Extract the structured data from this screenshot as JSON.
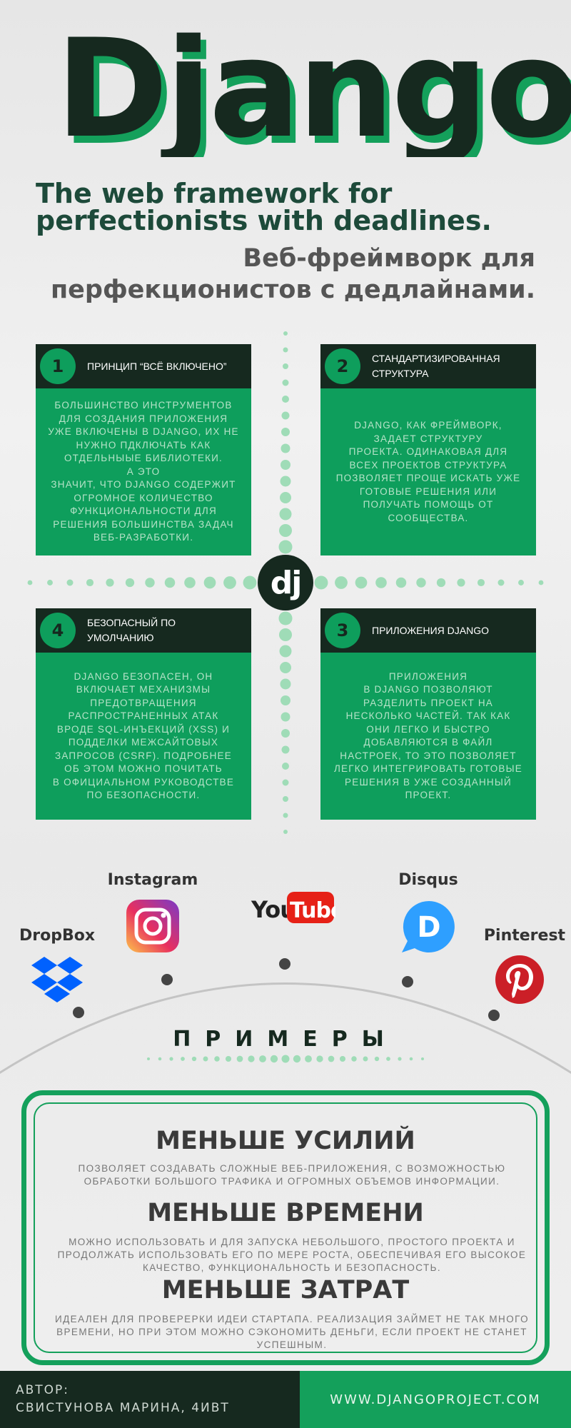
{
  "header": {
    "logo_text": "Django",
    "tagline_en_line1": "The web framework for",
    "tagline_en_line2": "perfectionists with deadlines.",
    "tagline_ru_line1": "Веб-фреймворк для",
    "tagline_ru_line2": "перфекционистов с дедлайнами."
  },
  "center_logo": "dj",
  "cards": [
    {
      "number": "1",
      "title": "ПРИНЦИП “ВСЁ ВКЛЮЧЕНО”",
      "text": "Большинство инструментов\nдля создания приложения\nуже включены в Django, их не\nнужно пдключать как\nотдельныые библиотеки.\nА это\nзначит, что Django содержит\nогромное количество\nфункциональности для\nрешения большинства задач\nвеб-разработки."
    },
    {
      "number": "2",
      "title": "СТАНДАРТИЗИРОВАННАЯ СТРУКТУРА",
      "text": "Django, как фреймворк,\nзадает структуру\nпроекта. Одинаковая для\nвсех проектов структура\nпозволяет проще искать уже\nготовые решения или\nполучать помощь от\nсообщества."
    },
    {
      "number": "3",
      "title": "ПРИЛОЖЕНИЯ DJANGO",
      "text": "Приложения\nв Django позволяют\nразделить проект на\nнесколько частей. Так как\nони легко и быстро\nдобавляются в файл\nнастроек, то это позволяет\nлегко интегрировать готовые\nрешения в уже созданный\nпроект."
    },
    {
      "number": "4",
      "title": "БЕЗОПАСНЫЙ ПО УМОЛЧАНИЮ",
      "text": "Django безопасен, он\nвключает механизмы\nпредотвращения\nраспространенных атак\nвроде SQL-инъекций (XSS) и\nподделки межсайтовых\nзапросов (CSRF). Подробнее\nоб этом можно почитать\nв официальном руководстве\nпо безопасности."
    }
  ],
  "examples": {
    "title": "ПРИМЕРЫ",
    "instagram": "Instagram",
    "disqus": "Disqus",
    "dropbox": "DropBox",
    "pinterest": "Pinterest",
    "youtube_you": "You",
    "youtube_tube": "Tube",
    "disqus_letter": "D",
    "icons": [
      "instagram-icon",
      "youtube-icon",
      "disqus-icon",
      "dropbox-icon",
      "pinterest-icon"
    ],
    "colors": {
      "youtube_red": "#e62117",
      "pinterest_red": "#cb1f27",
      "disqus_blue": "#2e9fff",
      "dropbox_blue": "#0061fe"
    }
  },
  "benefits": [
    {
      "title": "МЕНЬШЕ УСИЛИЙ",
      "text": "Позволяет создавать сложные веб-приложения, с возможностью обработки большого трафика и огромных объемов информации."
    },
    {
      "title": "МЕНЬШЕ ВРЕМЕНИ",
      "text": "Можно использовать и для запуска небольшого, простого проекта и продолжать использовать его по мере роста, обеспечивая его высокое качество, функциональность и безопасность."
    },
    {
      "title": "МЕНЬШЕ ЗАТРАТ",
      "text": "Идеален для проверерки идеи стартапа. Реализация займет не так много времени, но при этом можно сэкономить деньги, если проект не станет успешным."
    }
  ],
  "footer": {
    "author_label": "АВТОР:",
    "author_name": "СВИСТУНОВА МАРИНА, 4ИВТ",
    "site": "WWW.DJANGOPROJECT.COM"
  },
  "colors": {
    "green": "#0e9e5c",
    "dark": "#16291f",
    "light_green": "#9fdcb7"
  }
}
